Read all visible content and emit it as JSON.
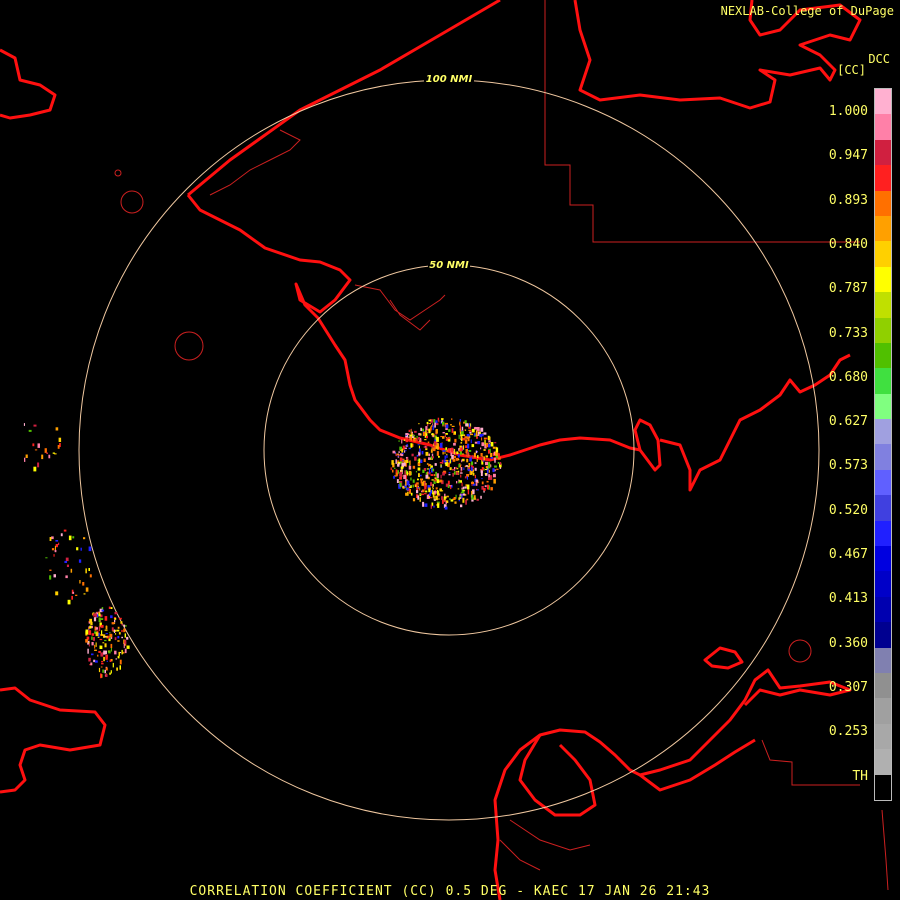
{
  "credit": "NEXLAB-College of DuPage",
  "legend": {
    "title": "DCC",
    "unit": "[CC]",
    "ticks": [
      "1.000",
      "0.947",
      "0.893",
      "0.840",
      "0.787",
      "0.733",
      "0.680",
      "0.627",
      "0.573",
      "0.520",
      "0.467",
      "0.413",
      "0.360",
      "0.307",
      "0.253",
      "TH"
    ],
    "colors": [
      "#ffb0d0",
      "#ff80a8",
      "#d02040",
      "#ff2020",
      "#ff7000",
      "#ffa000",
      "#ffd000",
      "#ffff00",
      "#c0e000",
      "#90d000",
      "#50c000",
      "#40e040",
      "#80ff80",
      "#a0a0e0",
      "#8080e0",
      "#6060ff",
      "#4040e0",
      "#2020ff",
      "#0000e0",
      "#0000c8",
      "#0000b0",
      "#000090",
      "#8080b0",
      "#909090",
      "#a0a0a0",
      "#a8a8a8",
      "#b0b0b0",
      "#000000"
    ]
  },
  "range_rings": {
    "inner_label": "50 NMI",
    "outer_label": "100 NMI"
  },
  "footer": "CORRELATION COEFFICIENT (CC) 0.5 DEG - KAEC 17 JAN 26 21:43",
  "map_colors": {
    "coast": "#ff1010",
    "boundary": "#cc2020",
    "ring": "#f0c8a0"
  }
}
